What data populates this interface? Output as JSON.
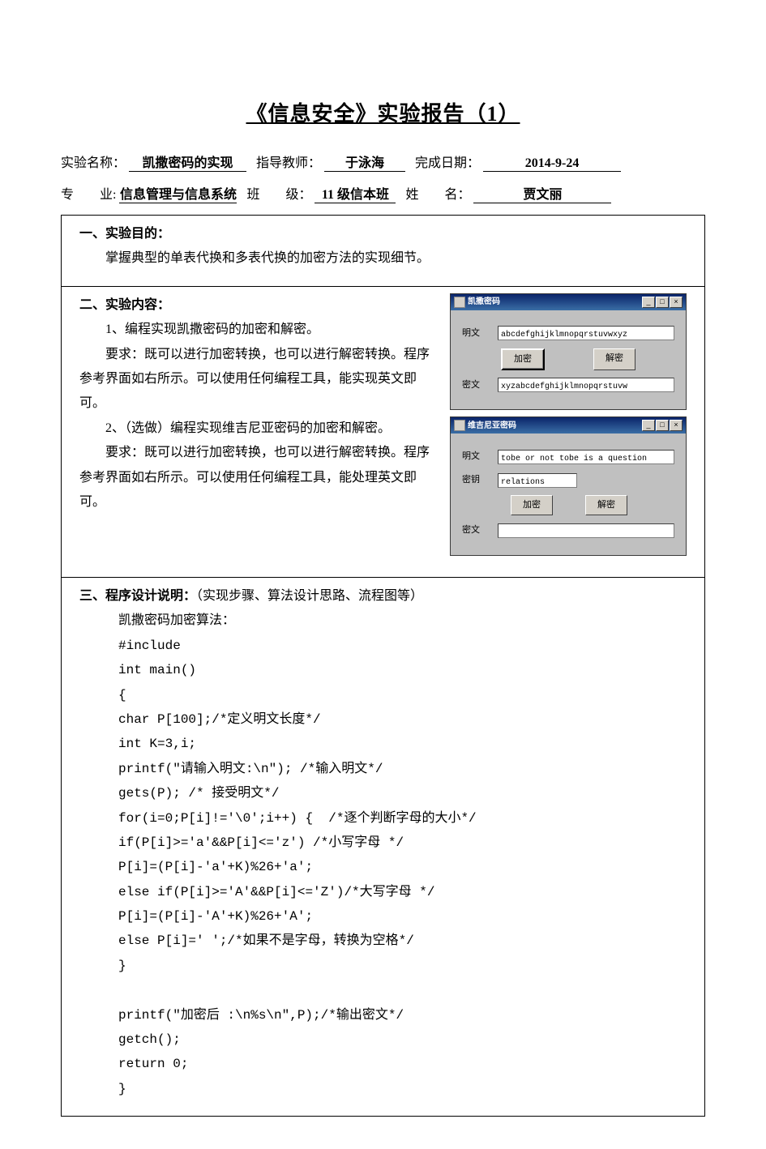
{
  "title": "《信息安全》实验报告（1）",
  "header": {
    "experiment_name_label": "实验名称：",
    "experiment_name": "凯撒密码的实现",
    "instructor_label": "指导教师：",
    "instructor": "于泳海",
    "date_label": "完成日期：",
    "date": "2014-9-24",
    "major_label": "专　　业:",
    "major": "信息管理与信息系统",
    "class_label": "班　　级：",
    "class": "11 级信本班",
    "name_label": "姓　　名：",
    "student_name": "贾文丽"
  },
  "s1": {
    "title": "一、实验目的：",
    "body": "掌握典型的单表代换和多表代换的加密方法的实现细节。"
  },
  "s2": {
    "title": "二、实验内容：",
    "p1": "1、编程实现凯撒密码的加密和解密。",
    "p2": "要求：既可以进行加密转换，也可以进行解密转换。程序参考界面如右所示。可以使用任何编程工具，能实现英文即可。",
    "p3": "2、（选做）编程实现维吉尼亚密码的加密和解密。",
    "p4": "要求：既可以进行加密转换，也可以进行解密转换。程序参考界面如右所示。可以使用任何编程工具，能处理英文即可。"
  },
  "win1": {
    "title": "凯撒密码",
    "label_plain": "明文",
    "value_plain": "abcdefghijklmnopqrstuvwxyz",
    "btn_encrypt": "加密",
    "btn_decrypt": "解密",
    "label_cipher": "密文",
    "value_cipher": "xyzabcdefghijklmnopqrstuvw"
  },
  "win2": {
    "title": "维吉尼亚密码",
    "label_plain": "明文",
    "value_plain": "tobe or not tobe is a question",
    "label_key": "密钥",
    "value_key": "relations",
    "btn_encrypt": "加密",
    "btn_decrypt": "解密",
    "label_cipher": "密文",
    "value_cipher": ""
  },
  "s3": {
    "title": "三、程序设计说明：",
    "subtitle": "（实现步骤、算法设计思路、流程图等）",
    "heading": "凯撒密码加密算法：",
    "code": "#include\nint main()\n{\nchar P[100];/*定义明文长度*/\nint K=3,i;\nprintf(\"请输入明文:\\n\"); /*输入明文*/\ngets(P); /* 接受明文*/\nfor(i=0;P[i]!='\\0';i++) {  /*逐个判断字母的大小*/\nif(P[i]>='a'&&P[i]<='z') /*小写字母 */\nP[i]=(P[i]-'a'+K)%26+'a';\nelse if(P[i]>='A'&&P[i]<='Z')/*大写字母 */\nP[i]=(P[i]-'A'+K)%26+'A';\nelse P[i]=' ';/*如果不是字母，转换为空格*/\n}\n\nprintf(\"加密后 :\\n%s\\n\",P);/*输出密文*/\ngetch();\nreturn 0;\n}"
  },
  "winctrl": {
    "min": "_",
    "max": "□",
    "close": "×"
  }
}
